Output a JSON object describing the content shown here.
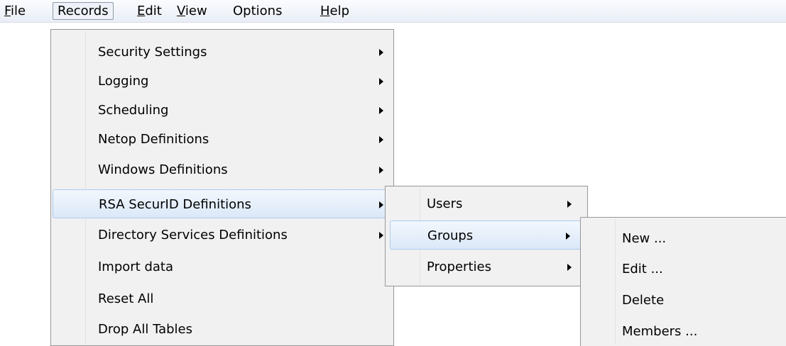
{
  "menubar": {
    "items": [
      {
        "mnemonic": "F",
        "rest": "ile"
      },
      {
        "mnemonic": "",
        "rest": "Records"
      },
      {
        "mnemonic": "E",
        "rest": "dit"
      },
      {
        "mnemonic": "V",
        "rest": "iew"
      },
      {
        "mnemonic": "",
        "rest": "Options"
      },
      {
        "mnemonic": "H",
        "rest": "elp"
      }
    ]
  },
  "records_menu": {
    "items": [
      {
        "label": "Security Settings"
      },
      {
        "label": "Logging"
      },
      {
        "label": "Scheduling"
      },
      {
        "label": "Netop Definitions"
      },
      {
        "label": "Windows Definitions"
      },
      {
        "label": "RSA SecurID Definitions"
      },
      {
        "label": "Directory Services Definitions"
      },
      {
        "label": "Import data"
      },
      {
        "label": "Reset All"
      },
      {
        "label": "Drop All Tables"
      }
    ]
  },
  "rsa_submenu": {
    "items": [
      {
        "label": "Users"
      },
      {
        "label": "Groups"
      },
      {
        "label": "Properties"
      }
    ]
  },
  "groups_submenu": {
    "items": [
      {
        "label": "New ..."
      },
      {
        "label": "Edit ..."
      },
      {
        "label": "Delete"
      },
      {
        "label": "Members ..."
      }
    ]
  }
}
